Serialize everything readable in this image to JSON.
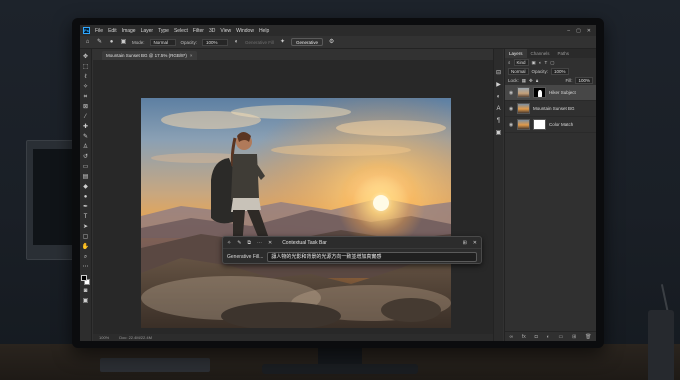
{
  "app": {
    "logo_text": "Ps",
    "menu": [
      "File",
      "Edit",
      "Image",
      "Layer",
      "Type",
      "Select",
      "Filter",
      "3D",
      "View",
      "Window",
      "Help"
    ],
    "window_controls": [
      "–",
      "▢",
      "✕"
    ]
  },
  "options_bar": {
    "mode_label": "Mode:",
    "mode_value": "Normal",
    "opacity_label": "Opacity:",
    "opacity_value": "100%",
    "generative_fill_dim": "Generative Fill",
    "generative_button": "Generative"
  },
  "document": {
    "tab_title": "Mountain Sunset BG @ 17.5% (RGB/8*)",
    "tab_close": "×",
    "status_zoom": "100%",
    "status_info": "Doc: 22.4M/22.4M"
  },
  "context_bar": {
    "title": "Contextual Task Bar",
    "label": "Generative Fill...",
    "prompt_text": "讓人物的光影和背景的光源方向一致並增加真實感"
  },
  "layers_panel": {
    "tabs": [
      "Layers",
      "Channels",
      "Paths"
    ],
    "active_tab": "Layers",
    "filter_label": "Kind",
    "blend_mode": "Normal",
    "opacity_label": "Opacity:",
    "opacity_value": "100%",
    "lock_label": "Lock:",
    "fill_label": "Fill:",
    "fill_value": "100%",
    "layers": [
      {
        "name": "Hiker Subject",
        "thumb": "subject",
        "selected": true
      },
      {
        "name": "Mountain Sunset BG",
        "thumb": "photo",
        "selected": false
      },
      {
        "name": "Color Match",
        "thumb": "white",
        "selected": false
      }
    ],
    "footer_icons": [
      "link-icon",
      "fx-icon",
      "mask-icon",
      "adjustment-icon",
      "folder-icon",
      "new-layer-icon",
      "trash-icon"
    ]
  },
  "colors": {
    "ps_accent": "#31a8ff",
    "panel_bg": "#303030",
    "canvas_bg": "#282828"
  }
}
